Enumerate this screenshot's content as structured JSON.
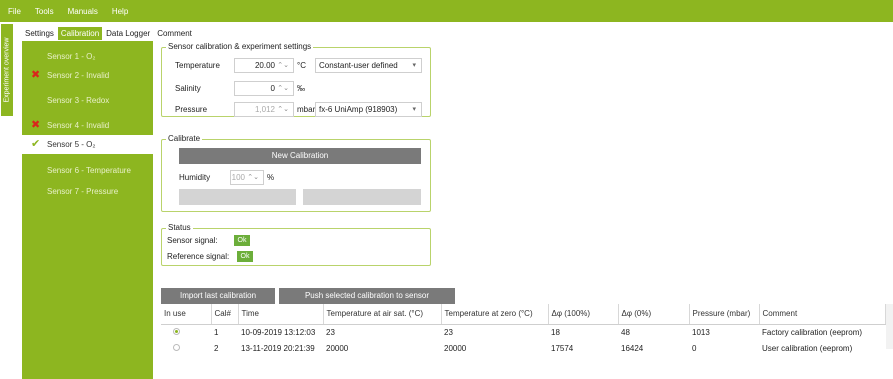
{
  "menu": [
    "File",
    "Tools",
    "Manuals",
    "Help"
  ],
  "side_tab": "Experiment overview",
  "tabs": [
    "Settings",
    "Calibration",
    "Data Logger",
    "Comment"
  ],
  "sensors": [
    {
      "label": "Sensor 1 - O₂",
      "mark": ""
    },
    {
      "label": "Sensor 2 - Invalid",
      "mark": "x"
    },
    {
      "label": "Sensor 3 - Redox",
      "mark": ""
    },
    {
      "label": "Sensor 4 - Invalid",
      "mark": "x"
    },
    {
      "label": "Sensor 5 - O₂",
      "mark": "check"
    },
    {
      "label": "Sensor 6 - Temperature",
      "mark": ""
    },
    {
      "label": "Sensor 7 - Pressure",
      "mark": ""
    }
  ],
  "settings": {
    "title": "Sensor calibration & experiment settings",
    "temperature_label": "Temperature",
    "temperature_value": "20.00",
    "temperature_unit": "°C",
    "temperature_mode": "Constant-user defined",
    "salinity_label": "Salinity",
    "salinity_value": "0",
    "salinity_unit": "‰",
    "pressure_label": "Pressure",
    "pressure_value": "1,012",
    "pressure_unit": "mbar",
    "pressure_source": "fx-6 UniAmp (918903)"
  },
  "calibrate": {
    "title": "Calibrate",
    "new_button": "New Calibration",
    "humidity_label": "Humidity",
    "humidity_value": "100",
    "humidity_unit": "%",
    "btn_left": "",
    "btn_right": ""
  },
  "status": {
    "title": "Status",
    "sensor_signal_label": "Sensor signal:",
    "sensor_signal_value": "Ok",
    "reference_signal_label": "Reference signal:",
    "reference_signal_value": "Ok"
  },
  "actions": {
    "import": "Import last calibration",
    "push": "Push selected calibration to sensor"
  },
  "table": {
    "headers": [
      "In use",
      "Cal#",
      "Time",
      "Temperature at air sat. (°C)",
      "Temperature at zero (°C)",
      "Δφ (100%)",
      "Δφ (0%)",
      "Pressure (mbar)",
      "Comment"
    ],
    "rows": [
      {
        "in_use": true,
        "cal": "1",
        "time": "10-09-2019 13:12:03",
        "t_air": "23",
        "t_zero": "23",
        "d100": "18",
        "d0": "48",
        "pressure": "1013",
        "comment": "Factory calibration (eeprom)"
      },
      {
        "in_use": false,
        "cal": "2",
        "time": "13-11-2019 20:21:39",
        "t_air": "20000",
        "t_zero": "20000",
        "d100": "17574",
        "d0": "16424",
        "pressure": "0",
        "comment": "User calibration (eeprom)"
      }
    ]
  },
  "colors": {
    "accent": "#8db620",
    "error": "#d9261c",
    "ok": "#6cae3a"
  }
}
